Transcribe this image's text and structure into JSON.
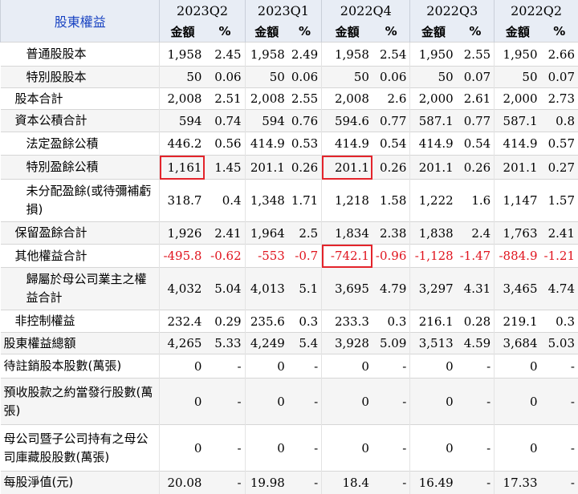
{
  "table": {
    "title": "股東權益",
    "periods": [
      "2023Q2",
      "2023Q1",
      "2022Q4",
      "2022Q3",
      "2022Q2"
    ],
    "sub_headers": {
      "amount": "金額",
      "pct": "%"
    },
    "rows": [
      {
        "label": "普通股股本",
        "values": [
          [
            "1,958",
            "2.45"
          ],
          [
            "1,958",
            "2.49"
          ],
          [
            "1,958",
            "2.54"
          ],
          [
            "1,950",
            "2.55"
          ],
          [
            "1,950",
            "2.66"
          ]
        ]
      },
      {
        "label": "特別股股本",
        "values": [
          [
            "50",
            "0.06"
          ],
          [
            "50",
            "0.06"
          ],
          [
            "50",
            "0.06"
          ],
          [
            "50",
            "0.07"
          ],
          [
            "50",
            "0.07"
          ]
        ]
      },
      {
        "label": "股本合計",
        "values": [
          [
            "2,008",
            "2.51"
          ],
          [
            "2,008",
            "2.55"
          ],
          [
            "2,008",
            "2.6"
          ],
          [
            "2,000",
            "2.61"
          ],
          [
            "2,000",
            "2.73"
          ]
        ]
      },
      {
        "label": "資本公積合計",
        "values": [
          [
            "594",
            "0.74"
          ],
          [
            "594",
            "0.76"
          ],
          [
            "594.6",
            "0.77"
          ],
          [
            "587.1",
            "0.77"
          ],
          [
            "587.1",
            "0.8"
          ]
        ]
      },
      {
        "label": "法定盈餘公積",
        "values": [
          [
            "446.2",
            "0.56"
          ],
          [
            "414.9",
            "0.53"
          ],
          [
            "414.9",
            "0.54"
          ],
          [
            "414.9",
            "0.54"
          ],
          [
            "414.9",
            "0.57"
          ]
        ]
      },
      {
        "label": "特別盈餘公積",
        "values": [
          [
            "1,161",
            "1.45"
          ],
          [
            "201.1",
            "0.26"
          ],
          [
            "201.1",
            "0.26"
          ],
          [
            "201.1",
            "0.26"
          ],
          [
            "201.1",
            "0.27"
          ]
        ]
      },
      {
        "label": "未分配盈餘(或待彌補虧損)",
        "values": [
          [
            "318.7",
            "0.4"
          ],
          [
            "1,348",
            "1.71"
          ],
          [
            "1,218",
            "1.58"
          ],
          [
            "1,222",
            "1.6"
          ],
          [
            "1,147",
            "1.57"
          ]
        ]
      },
      {
        "label": "保留盈餘合計",
        "values": [
          [
            "1,926",
            "2.41"
          ],
          [
            "1,964",
            "2.5"
          ],
          [
            "1,834",
            "2.38"
          ],
          [
            "1,838",
            "2.4"
          ],
          [
            "1,763",
            "2.41"
          ]
        ]
      },
      {
        "label": "其他權益合計",
        "values": [
          [
            "-495.8",
            "-0.62"
          ],
          [
            "-553",
            "-0.7"
          ],
          [
            "-742.1",
            "-0.96"
          ],
          [
            "-1,128",
            "-1.47"
          ],
          [
            "-884.9",
            "-1.21"
          ]
        ]
      },
      {
        "label": "歸屬於母公司業主之權益合計",
        "values": [
          [
            "4,032",
            "5.04"
          ],
          [
            "4,013",
            "5.1"
          ],
          [
            "3,695",
            "4.79"
          ],
          [
            "3,297",
            "4.31"
          ],
          [
            "3,465",
            "4.74"
          ]
        ]
      },
      {
        "label": "非控制權益",
        "values": [
          [
            "232.4",
            "0.29"
          ],
          [
            "235.6",
            "0.3"
          ],
          [
            "233.3",
            "0.3"
          ],
          [
            "216.1",
            "0.28"
          ],
          [
            "219.1",
            "0.3"
          ]
        ]
      },
      {
        "label": "股東權益總額",
        "values": [
          [
            "4,265",
            "5.33"
          ],
          [
            "4,249",
            "5.4"
          ],
          [
            "3,928",
            "5.09"
          ],
          [
            "3,513",
            "4.59"
          ],
          [
            "3,684",
            "5.03"
          ]
        ]
      },
      {
        "label": "待註銷股本股數(萬張)",
        "values": [
          [
            "0",
            "-"
          ],
          [
            "0",
            "-"
          ],
          [
            "0",
            "-"
          ],
          [
            "0",
            "-"
          ],
          [
            "0",
            "-"
          ]
        ]
      },
      {
        "label": "預收股款之約當發行股數(萬張)",
        "values": [
          [
            "0",
            "-"
          ],
          [
            "0",
            "-"
          ],
          [
            "0",
            "-"
          ],
          [
            "0",
            "-"
          ],
          [
            "0",
            "-"
          ]
        ]
      },
      {
        "label": "母公司暨子公司持有之母公司庫藏股股數(萬張)",
        "values": [
          [
            "0",
            "-"
          ],
          [
            "0",
            "-"
          ],
          [
            "0",
            "-"
          ],
          [
            "0",
            "-"
          ],
          [
            "0",
            "-"
          ]
        ]
      },
      {
        "label": "每股淨值(元)",
        "values": [
          [
            "20.08",
            "-"
          ],
          [
            "19.98",
            "-"
          ],
          [
            "18.4",
            "-"
          ],
          [
            "16.49",
            "-"
          ],
          [
            "17.33",
            "-"
          ]
        ]
      }
    ]
  },
  "colors": {
    "header_bg": "#e8edf5",
    "title_text": "#1a44c2",
    "negative": "#e0141e",
    "highlight_box": "#e3242b"
  }
}
